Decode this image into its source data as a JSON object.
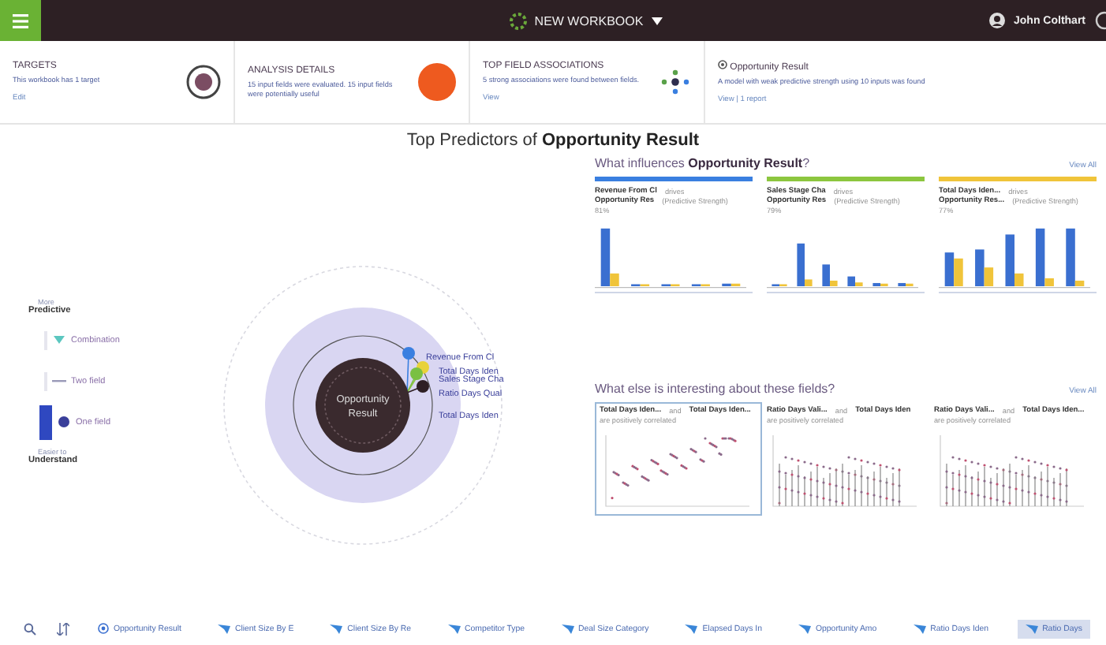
{
  "header": {
    "title": "NEW WORKBOOK",
    "user": "John Colthart"
  },
  "summary_cards": [
    {
      "kind": "targets",
      "title": "TARGETS",
      "text": "This workbook has 1 target",
      "link": "Edit"
    },
    {
      "kind": "analysis",
      "title": "ANALYSIS DETAILS",
      "text": "15 input fields were evaluated. 15 input fields were potentially useful"
    },
    {
      "kind": "associations",
      "title": "TOP FIELD ASSOCIATIONS",
      "text": "5 strong associations were found between fields.",
      "link": "View"
    },
    {
      "kind": "result",
      "title": "Opportunity Result",
      "text": "A model with weak predictive strength using 10 inputs was found",
      "link": "View | 1 report"
    }
  ],
  "main_title": "Top Predictors of **Opportunity Result**",
  "legend": {
    "top_small": "More",
    "top": "Predictive",
    "bottom_small": "Easier to",
    "bottom": "Understand",
    "items": [
      {
        "kind": "combination",
        "label": "Combination",
        "selected": false
      },
      {
        "kind": "two",
        "label": "Two field",
        "selected": false
      },
      {
        "kind": "one",
        "label": "One field",
        "selected": true
      }
    ]
  },
  "radial": {
    "center": "Opportunity Result",
    "predictors": [
      {
        "label": "Revenue From Cl",
        "color": "#3a7fe0"
      },
      {
        "label": "Total Days Iden",
        "color": "#e8d23a"
      },
      {
        "label": "Sales Stage Cha",
        "color": "#7ac043"
      },
      {
        "label": "Ratio Days Qual",
        "color": "#2e1f24"
      },
      {
        "label": "Total Days Iden"
      }
    ]
  },
  "influences": {
    "title": "What influences **Opportunity Result**?",
    "link": "View All",
    "cards": [
      {
        "color": "#3a7fe0",
        "field": "Revenue From Cl",
        "verb": "drives",
        "target": "Opportunity Res",
        "measure": "(Predictive Strength)",
        "percent": "81%"
      },
      {
        "color": "#8cc63f",
        "field": "Sales Stage Cha",
        "verb": "drives",
        "target": "Opportunity Res",
        "measure": "(Predictive Strength)",
        "percent": "79%"
      },
      {
        "color": "#f0c43a",
        "field": "Total Days Iden...",
        "verb": "drives",
        "target": "Opportunity Res...",
        "measure": "(Predictive Strength)",
        "percent": "77%"
      }
    ]
  },
  "interesting": {
    "title": "What else is interesting about these fields?",
    "link": "View All",
    "cards": [
      {
        "field_a": "Total Days Iden...",
        "joiner": "and",
        "field_b": "Total Days Iden...",
        "text": "are positively correlated",
        "selected": true
      },
      {
        "field_a": "Ratio Days Vali...",
        "joiner": "and",
        "field_b": "Total Days Iden",
        "text": "are positively correlated",
        "selected": false
      },
      {
        "field_a": "Ratio Days Vali...",
        "joiner": "and",
        "field_b": "Total Days Iden...",
        "text": "are positively correlated",
        "selected": false
      }
    ]
  },
  "field_bar": [
    {
      "kind": "target",
      "label": "Opportunity Result",
      "selected": false
    },
    {
      "kind": "field",
      "label": "Client Size By E",
      "selected": false
    },
    {
      "kind": "field",
      "label": "Client Size By Re",
      "selected": false
    },
    {
      "kind": "field",
      "label": "Competitor Type",
      "selected": false
    },
    {
      "kind": "field",
      "label": "Deal Size Category",
      "selected": false
    },
    {
      "kind": "field",
      "label": "Elapsed Days In",
      "selected": false
    },
    {
      "kind": "field",
      "label": "Opportunity Amo",
      "selected": false
    },
    {
      "kind": "field",
      "label": "Ratio Days Iden",
      "selected": false
    },
    {
      "kind": "field",
      "label": "Ratio Days",
      "selected": true
    }
  ]
}
